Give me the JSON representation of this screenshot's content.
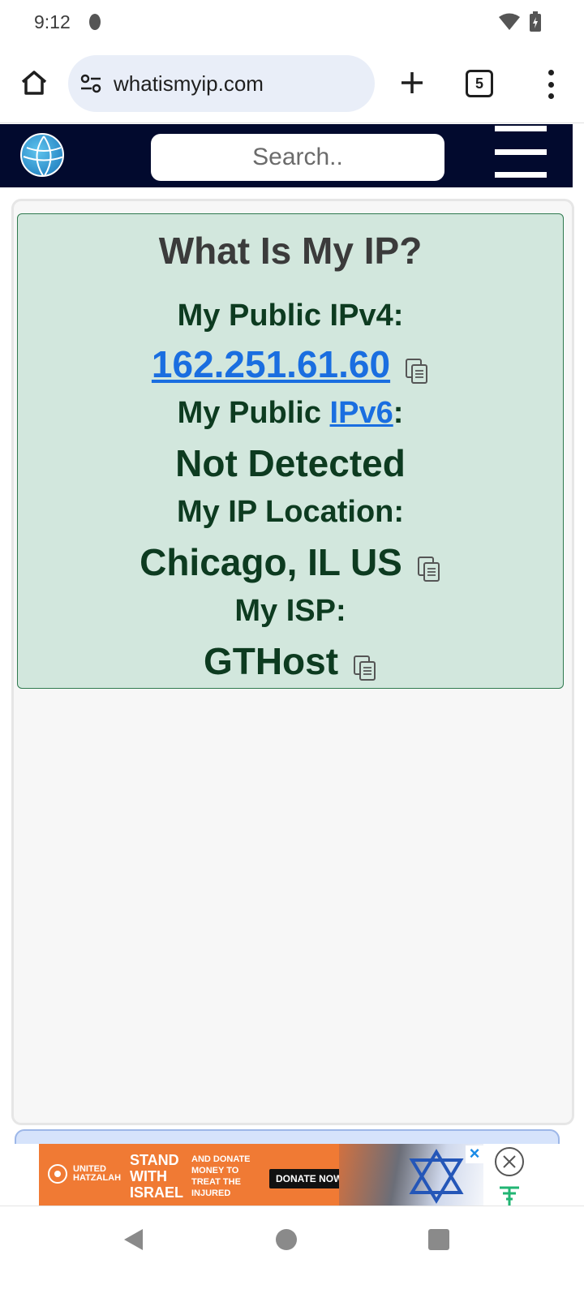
{
  "status_bar": {
    "time": "9:12"
  },
  "browser": {
    "url": "whatismyip.com",
    "tab_count": "5"
  },
  "site_header": {
    "search_placeholder": "Search.."
  },
  "ip_card": {
    "title": "What Is My IP?",
    "ipv4_label": "My Public IPv4:",
    "ipv4_value": "162.251.61.60",
    "ipv6_label_prefix": "My Public ",
    "ipv6_label_link": "IPv6",
    "ipv6_label_suffix": ":",
    "ipv6_value": "Not Detected",
    "location_label": "My IP Location:",
    "location_value": "Chicago, IL US",
    "isp_label": "My ISP:",
    "isp_value": "GTHost"
  },
  "ad": {
    "logo_line1": "UNITED",
    "logo_line2": "HATZALAH",
    "stand_line1": "STAND",
    "stand_line2": "WITH",
    "stand_line3": "ISRAEL",
    "sub_line1": "AND DONATE",
    "sub_line2": "MONEY TO",
    "sub_line3": "TREAT THE",
    "sub_line4": "INJURED",
    "donate_label": "DONATE NOW"
  },
  "colors": {
    "header_bg": "#020a2e",
    "card_bg": "#d2e7dd",
    "text_green": "#0d3b20",
    "link_blue": "#1a6ee0",
    "ad_orange": "#f07a34"
  }
}
